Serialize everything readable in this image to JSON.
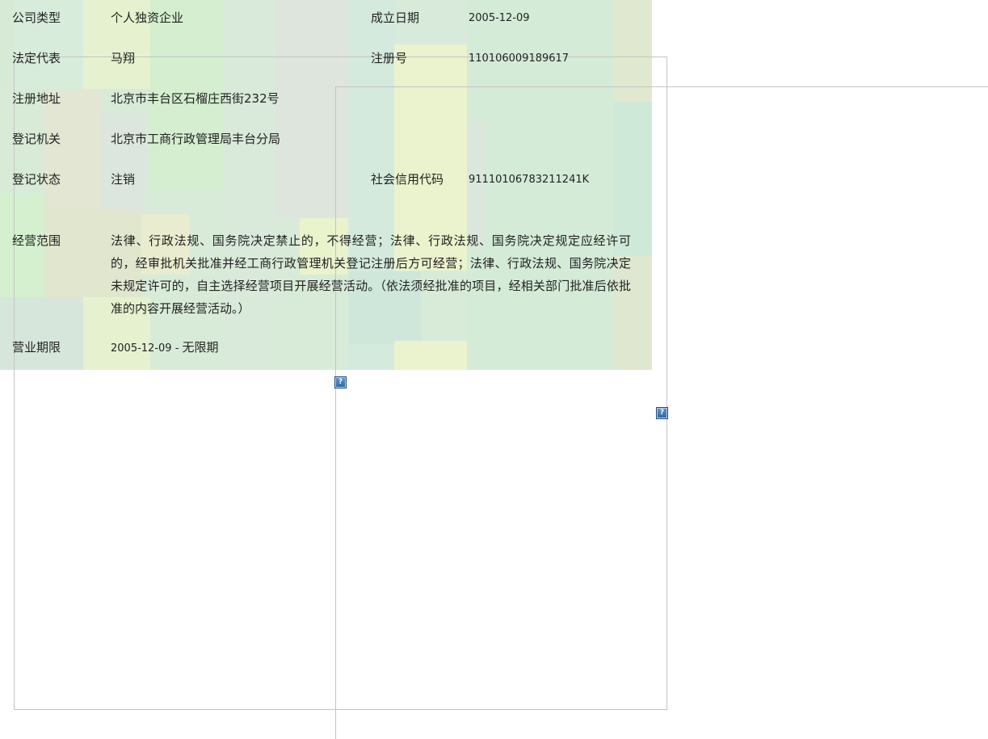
{
  "company": {
    "type_label": "公司类型",
    "type_value": "个人独资企业",
    "founded_label": "成立日期",
    "founded_value": "2005-12-09",
    "legal_rep_label": "法定代表",
    "legal_rep_value": "马翔",
    "reg_no_label": "注册号",
    "reg_no_value": "110106009189617",
    "address_label": "注册地址",
    "address_value": "北京市丰台区石榴庄西街232号",
    "authority_label": "登记机关",
    "authority_value": "北京市工商行政管理局丰台分局",
    "status_label": "登记状态",
    "status_value": "注销",
    "credit_code_label": "社会信用代码",
    "credit_code_value": "91110106783211241K",
    "scope_label": "经营范围",
    "scope_value": "法律、行政法规、国务院决定禁止的，不得经营；法律、行政法规、国务院决定规定应经许可的，经审批机关批准并经工商行政管理机关登记注册后方可经营；法律、行政法规、国务院决定未规定许可的，自主选择经营项目开展经营活动。（依法须经批准的项目，经相关部门批准后依批准的内容开展经营活动。）",
    "term_label": "营业期限",
    "term_value_dates": "2005-12-09",
    "term_value_sep": " - ",
    "term_value_end": "无限期"
  },
  "icons": {
    "help_a": "?",
    "help_b": "?"
  },
  "colors": {
    "mosaic_base": "#d8ebd8",
    "help_icon": "#2e66a0"
  }
}
